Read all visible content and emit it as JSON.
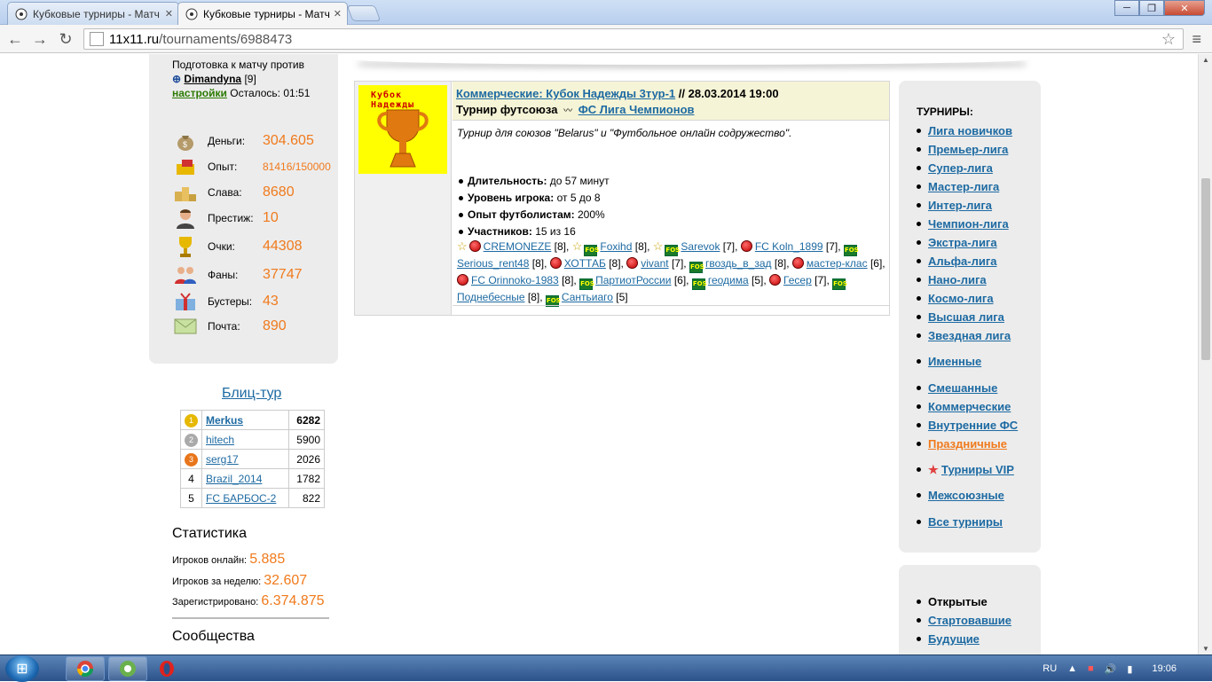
{
  "browser": {
    "tabs": [
      {
        "label": "Кубковые турниры - Матч"
      },
      {
        "label": "Кубковые турниры - Матч"
      }
    ],
    "url_domain": "11x11.ru",
    "url_path": "/tournaments/6988473"
  },
  "left": {
    "prep_text": "Подготовка к матчу против",
    "opponent": "Dimandyna",
    "opponent_level": "[9]",
    "settings": "настройки",
    "remaining_label": "Осталось:",
    "remaining_time": "01:51",
    "stats": [
      {
        "icon": "money-bag-icon",
        "label": "Деньги:",
        "value": "304.605"
      },
      {
        "icon": "experience-icon",
        "label": "Опыт:",
        "value": "81416/150000"
      },
      {
        "icon": "podium-icon",
        "label": "Слава:",
        "value": "8680"
      },
      {
        "icon": "prestige-icon",
        "label": "Престиж:",
        "value": "10"
      },
      {
        "icon": "trophy-icon",
        "label": "Очки:",
        "value": "44308"
      },
      {
        "icon": "fans-icon",
        "label": "Фаны:",
        "value": "37747"
      },
      {
        "icon": "gift-icon",
        "label": "Бустеры:",
        "value": "43"
      },
      {
        "icon": "mail-icon",
        "label": "Почта:",
        "value": "890"
      }
    ],
    "blitz_title": "Блиц-тур",
    "blitz": [
      {
        "rank": "1",
        "name": "Merkus",
        "score": "6282"
      },
      {
        "rank": "2",
        "name": "hitech",
        "score": "5900"
      },
      {
        "rank": "3",
        "name": "serg17",
        "score": "2026"
      },
      {
        "rank": "4",
        "name": "Brazil_2014",
        "score": "1782"
      },
      {
        "rank": "5",
        "name": "FC БАРБОС-2",
        "score": "822"
      }
    ],
    "stats_title": "Статистика",
    "online_label": "Игроков онлайн:",
    "online_value": "5.885",
    "week_label": "Игроков за неделю:",
    "week_value": "32.607",
    "reg_label": "Зарегистрировано:",
    "reg_value": "6.374.875",
    "communities_title": "Сообщества"
  },
  "tournament": {
    "cup_title": "Кубок Надежды",
    "title_link": "Коммерческие: Кубок Надежды 3тур-1",
    "separator": "//",
    "date": "28.03.2014 19:00",
    "federation_label": "Турнир футсоюза",
    "federation_link": "ФС Лига Чемпионов",
    "description": "Турнир для союзов \"Belarus\" и \"Футбольное онлайн содружество\".",
    "duration_label": "Длительность:",
    "duration_value": "до 57 минут",
    "level_label": "Уровень игрока:",
    "level_value": "от 5 до 8",
    "exp_label": "Опыт футболистам:",
    "exp_value": "200%",
    "participants_label": "Участников:",
    "participants_value": "15 из 16",
    "participants": [
      {
        "star": true,
        "flag": "by",
        "name": "CREMONEZE",
        "lvl": "[8],"
      },
      {
        "star": true,
        "flag": "fs",
        "name": "Foxihd",
        "lvl": "[8],"
      },
      {
        "star": true,
        "flag": "fs",
        "name": "Sarevok",
        "lvl": "[7],"
      },
      {
        "star": false,
        "flag": "by",
        "name": "FC Koln_1899",
        "lvl": "[7],"
      },
      {
        "star": false,
        "flag": "fs",
        "name": "Serious_rent48",
        "lvl": "[8],"
      },
      {
        "star": false,
        "flag": "by",
        "name": "ХОТТАБ",
        "lvl": "[8],"
      },
      {
        "star": false,
        "flag": "by",
        "name": "vivant",
        "lvl": "[7],"
      },
      {
        "star": false,
        "flag": "fs",
        "name": "гвоздь_в_зад",
        "lvl": "[8],"
      },
      {
        "star": false,
        "flag": "by",
        "name": "мастер-клас",
        "lvl": "[6],"
      },
      {
        "star": false,
        "flag": "by",
        "name": "FC Orinnoko-1983",
        "lvl": "[8],"
      },
      {
        "star": false,
        "flag": "fs",
        "name": "ПартиотРоссии",
        "lvl": "[6],"
      },
      {
        "star": false,
        "flag": "fs",
        "name": "геодима",
        "lvl": "[5],"
      },
      {
        "star": false,
        "flag": "by",
        "name": "Гесер",
        "lvl": "[7],"
      },
      {
        "star": false,
        "flag": "fs",
        "name": "Поднебесные",
        "lvl": "[8],"
      },
      {
        "star": false,
        "flag": "fs",
        "name": "Сантьиаго",
        "lvl": "[5]"
      }
    ]
  },
  "right": {
    "tournaments_title": "ТУРНИРЫ:",
    "group1": [
      "Лига новичков",
      "Премьер-лига",
      "Супер-лига",
      "Мастер-лига",
      "Интер-лига",
      "Чемпион-лига",
      "Экстра-лига",
      "Альфа-лига",
      "Нано-лига",
      "Космо-лига",
      "Высшая лига",
      "Звездная лига"
    ],
    "named": "Именные",
    "group2": [
      "Смешанные",
      "Коммерческие",
      "Внутренние ФС",
      "Праздничные"
    ],
    "vip": "Турниры VIP",
    "inter": "Межсоюзные",
    "all": "Все турниры",
    "status_open": "Открытые",
    "status_started": "Стартовавшие",
    "status_future": "Будущие"
  },
  "taskbar": {
    "lang": "RU",
    "time": "19:06"
  },
  "colors": {
    "accent": "#f07a1c",
    "link": "#1d6aa2"
  }
}
